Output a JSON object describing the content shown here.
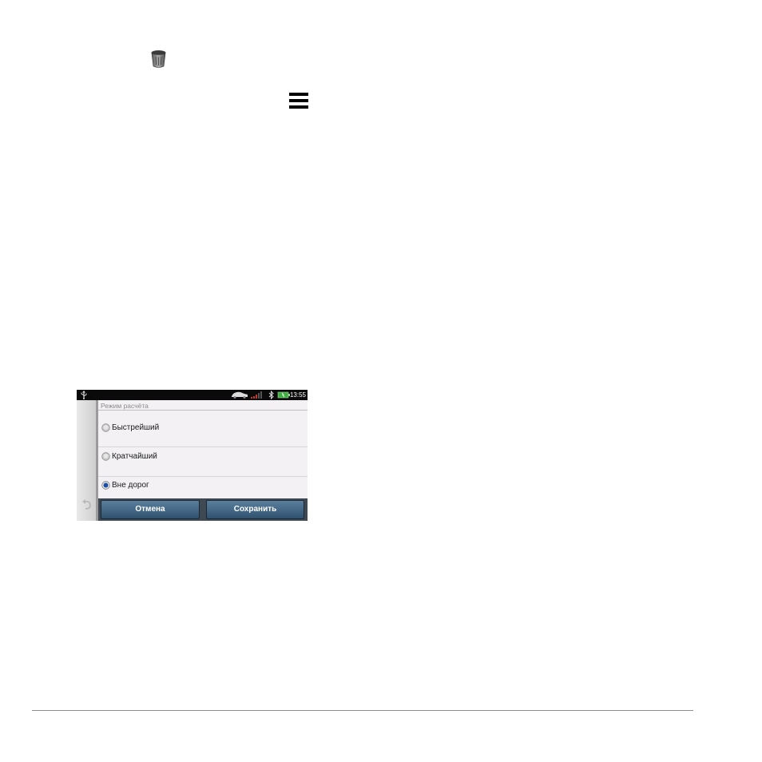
{
  "icons": {
    "trash": "trash-icon",
    "menu": "menu-icon"
  },
  "device": {
    "status_bar": {
      "time": "13:55",
      "icons": [
        "usb-icon",
        "car-icon",
        "signal-icon",
        "bluetooth-icon",
        "battery-icon"
      ]
    },
    "dialog": {
      "title": "Режим расчёта",
      "options": [
        {
          "label": "Быстрейший",
          "selected": false
        },
        {
          "label": "Кратчайший",
          "selected": false
        },
        {
          "label": "Вне дорог",
          "selected": true
        }
      ],
      "buttons": {
        "cancel": "Отмена",
        "save": "Сохранить"
      }
    }
  },
  "colors": {
    "button_top": "#5a7f9d",
    "button_bottom": "#2f5271",
    "radio_selected": "#1e4fa8",
    "signal": "#c0392b",
    "battery": "#3fae3f"
  }
}
